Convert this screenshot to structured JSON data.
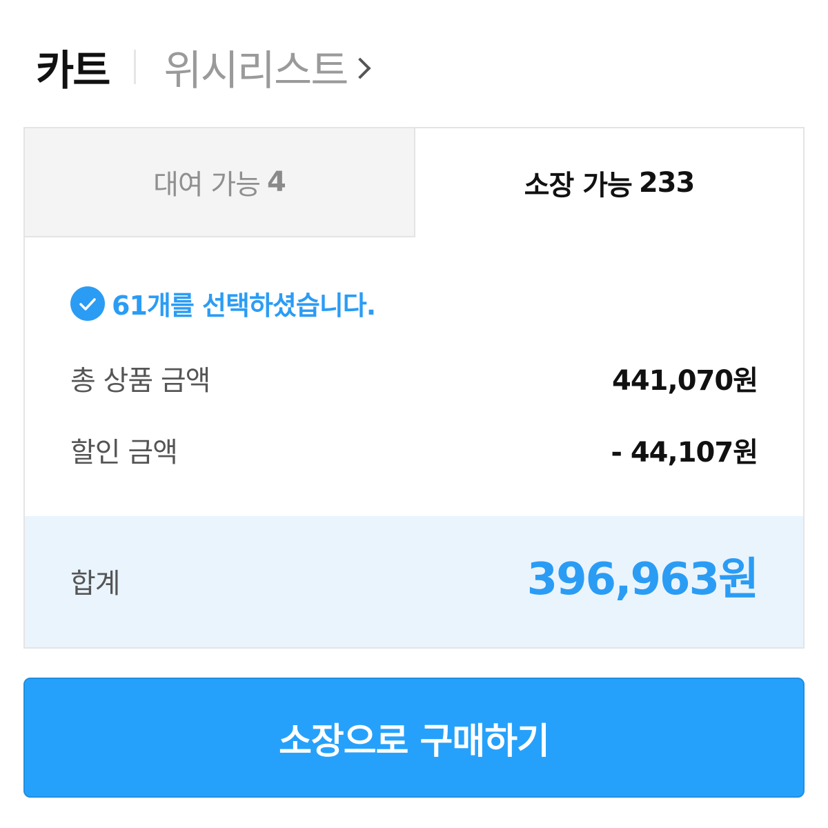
{
  "header": {
    "cart_label": "카트",
    "wishlist_label": "위시리스트"
  },
  "tabs": [
    {
      "label": "대여 가능",
      "count": "4",
      "active": false
    },
    {
      "label": "소장 가능",
      "count": "233",
      "active": true
    }
  ],
  "selection": {
    "text": "61개를 선택하셨습니다.",
    "icon": "check-circle-icon"
  },
  "summary": {
    "total_label": "총 상품 금액",
    "total_value": "441,070원",
    "discount_label": "할인 금액",
    "discount_value": "- 44,107원",
    "sum_label": "합계",
    "sum_value": "396,963원"
  },
  "button": {
    "label": "소장으로 구매하기"
  },
  "colors": {
    "accent": "#2b9cf4",
    "button": "#26a1fb",
    "total_bg": "#eaf4fd",
    "inactive_tab_bg": "#f4f4f4"
  }
}
